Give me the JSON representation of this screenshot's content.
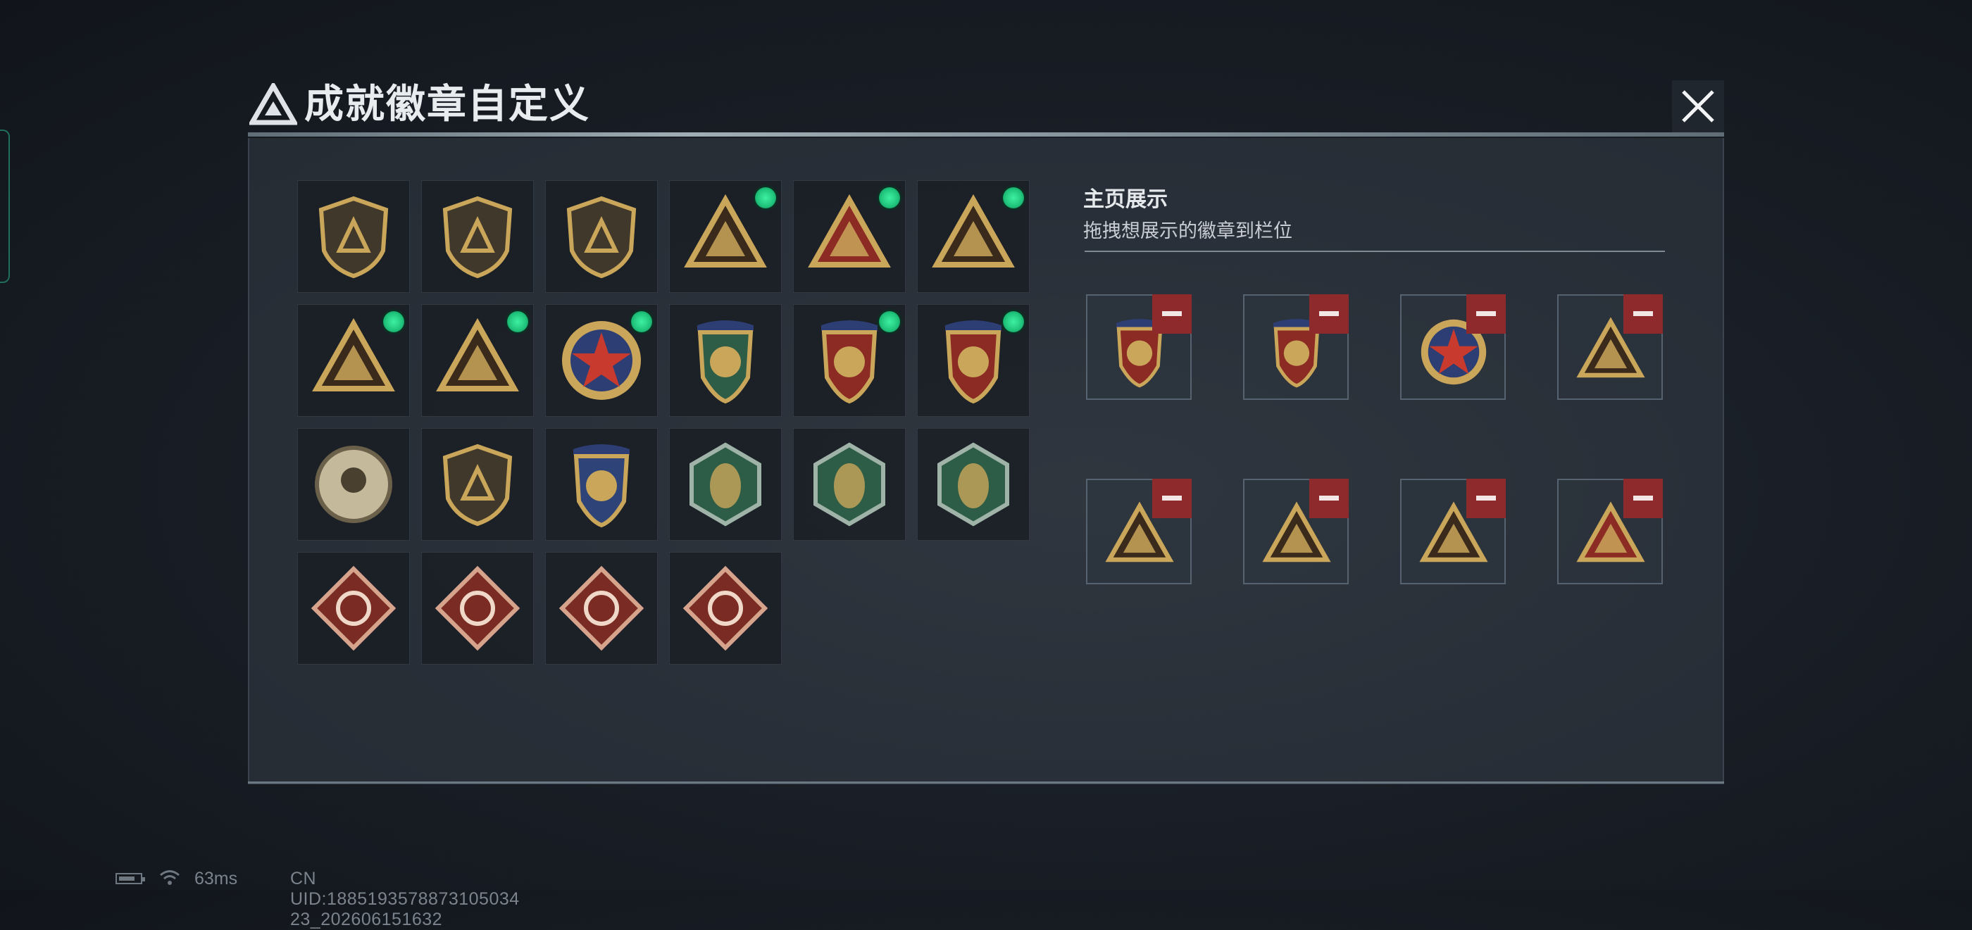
{
  "dialog": {
    "title": "成就徽章自定义"
  },
  "colors": {
    "gold": "#caa65a",
    "red_badge": "#8c2a24",
    "green_badge": "#2d5d46",
    "equipped_indicator": "#22d486",
    "remove_button": "#8e2a2c"
  },
  "collection": {
    "badges": [
      {
        "name": "triangle-shield-badge",
        "equipped": false
      },
      {
        "name": "helicopter-shield-badge",
        "equipped": false
      },
      {
        "name": "dagger-shield-badge",
        "equipped": false
      },
      {
        "name": "wave-triangle-badge",
        "equipped": true
      },
      {
        "name": "number-one-triangle-badge",
        "equipped": true
      },
      {
        "name": "figure-triangle-badge",
        "equipped": true
      },
      {
        "name": "gem-triangle-badge",
        "equipped": true
      },
      {
        "name": "squad-triangle-badge",
        "equipped": true
      },
      {
        "name": "star-medal-badge",
        "equipped": true
      },
      {
        "name": "green-crest-badge",
        "equipped": false
      },
      {
        "name": "winged-crest-badge",
        "equipped": true
      },
      {
        "name": "red-crest-badge",
        "equipped": true
      },
      {
        "name": "skull-round-badge",
        "equipped": false
      },
      {
        "name": "rifle-shield-badge",
        "equipped": false
      },
      {
        "name": "blue-wing-crest-badge",
        "equipped": false
      },
      {
        "name": "wasp-hexagon-badge",
        "equipped": false
      },
      {
        "name": "hornet-hexagon-badge",
        "equipped": false
      },
      {
        "name": "medic-hexagon-badge",
        "equipped": false
      },
      {
        "name": "dragon-diamond-badge",
        "equipped": false
      },
      {
        "name": "runner-diamond-badge",
        "equipped": false
      },
      {
        "name": "crossed-weapons-diamond-badge",
        "equipped": false
      },
      {
        "name": "wrench-diamond-badge",
        "equipped": false
      }
    ]
  },
  "showcase": {
    "title": "主页展示",
    "subtitle": "拖拽想展示的徽章到栏位",
    "slots": [
      {
        "badge": "red-crest-badge"
      },
      {
        "badge": "winged-crest-badge"
      },
      {
        "badge": "star-medal-badge"
      },
      {
        "badge": "wave-triangle-badge"
      },
      {
        "badge": "gem-triangle-badge"
      },
      {
        "badge": "figure-triangle-badge"
      },
      {
        "badge": "squad-triangle-badge"
      },
      {
        "badge": "number-one-triangle-badge"
      }
    ]
  },
  "status_bar": {
    "latency": "63ms",
    "uid": "CN UID:1885193578873105034​23_202606151632"
  }
}
